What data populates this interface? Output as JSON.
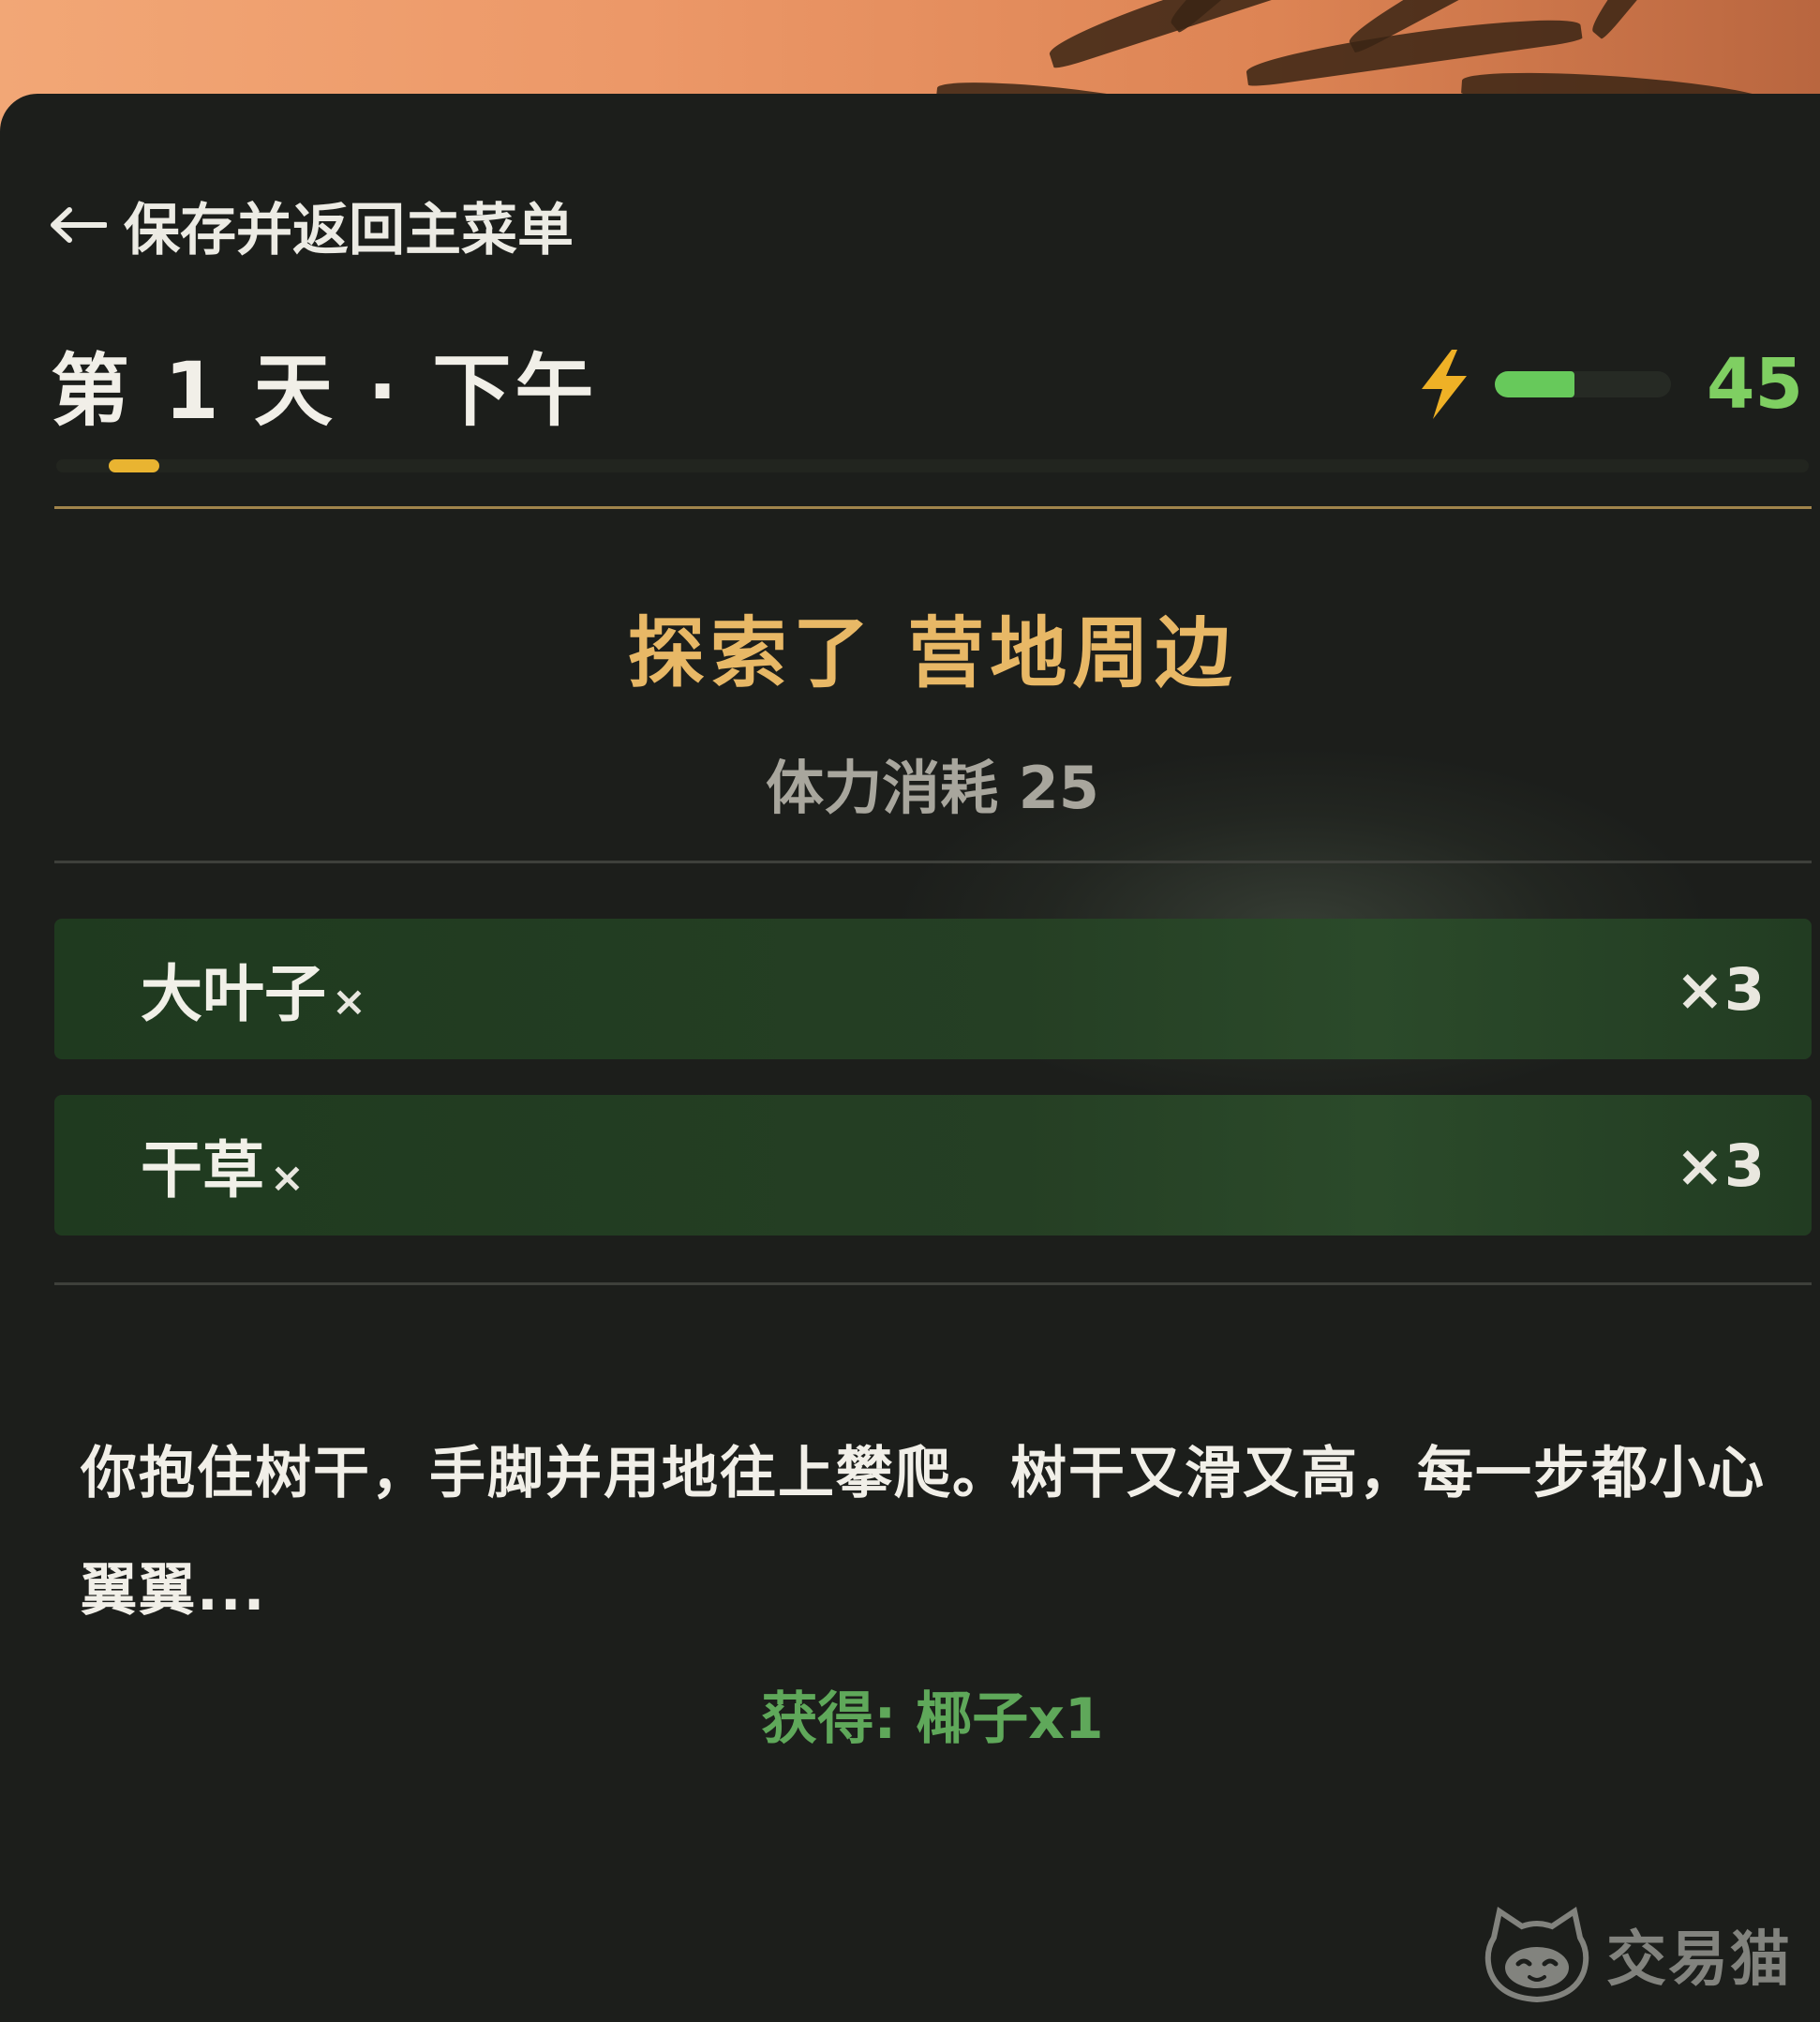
{
  "header": {
    "back_label": "保存并返回主菜单",
    "day_title": "第 1 天 · 下午",
    "energy": {
      "value": "45",
      "fill_fraction": 0.45,
      "bar_color": "#67c95b",
      "icon": "lightning-bolt-icon"
    }
  },
  "result": {
    "title": "探索了 营地周边",
    "stamina_cost": "体力消耗 25"
  },
  "loot": [
    {
      "name": "大叶子",
      "x_mark": "×",
      "quantity": "×3"
    },
    {
      "name": "干草",
      "x_mark": "×",
      "quantity": "×3"
    }
  ],
  "narrative": {
    "text": "你抱住树干，手脚并用地往上攀爬。树干又滑又高，每一步都小心翼翼...",
    "gain": "获得: 椰子x1"
  },
  "watermark": {
    "text": "交易猫"
  },
  "colors": {
    "panel_bg": "#1c1e1b",
    "gold_accent": "#e8b866",
    "green_accent": "#5fa85a",
    "loot_row_bg": "#253f24"
  }
}
